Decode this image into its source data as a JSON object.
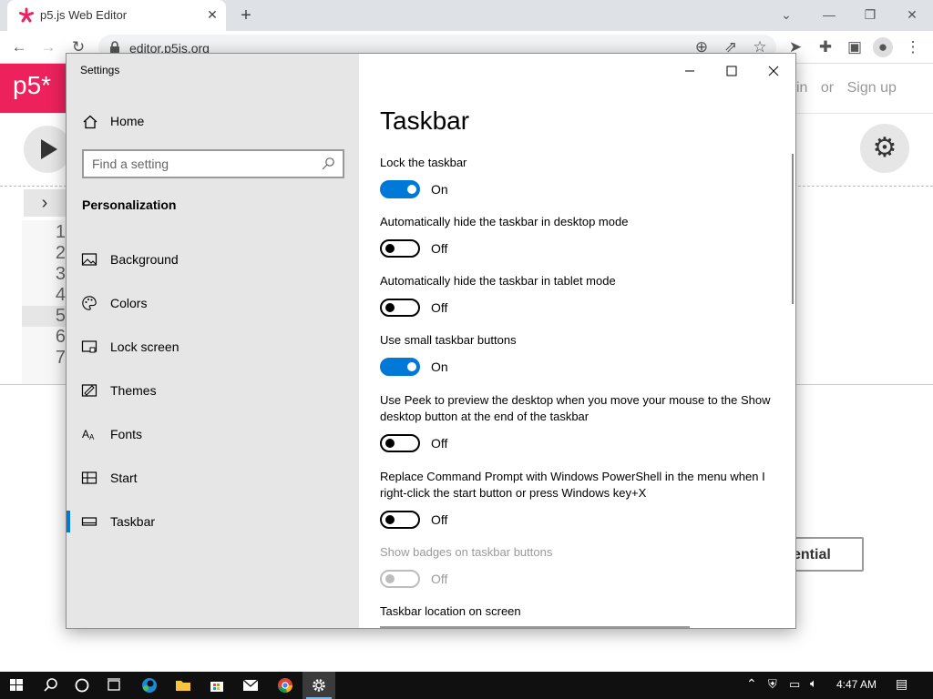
{
  "browser": {
    "tab_title": "p5.js Web Editor",
    "url": "editor.p5js.org"
  },
  "p5": {
    "logo": "p5*",
    "nav_login": "in",
    "nav_or": "or",
    "nav_signup": "Sign up",
    "line_numbers": [
      "1",
      "2",
      "3",
      "4",
      "5",
      "6",
      "7"
    ],
    "credential_button": "ential"
  },
  "settings": {
    "window_title": "Settings",
    "home_label": "Home",
    "search_placeholder": "Find a setting",
    "section": "Personalization",
    "nav_items": [
      {
        "label": "Background",
        "icon": "background-icon"
      },
      {
        "label": "Colors",
        "icon": "palette-icon"
      },
      {
        "label": "Lock screen",
        "icon": "lock-screen-icon"
      },
      {
        "label": "Themes",
        "icon": "themes-icon"
      },
      {
        "label": "Fonts",
        "icon": "fonts-icon"
      },
      {
        "label": "Start",
        "icon": "start-icon"
      },
      {
        "label": "Taskbar",
        "icon": "taskbar-icon",
        "active": true
      }
    ],
    "page_title": "Taskbar",
    "options": [
      {
        "label": "Lock the taskbar",
        "state": "On"
      },
      {
        "label": "Automatically hide the taskbar in desktop mode",
        "state": "Off"
      },
      {
        "label": "Automatically hide the taskbar in tablet mode",
        "state": "Off"
      },
      {
        "label": "Use small taskbar buttons",
        "state": "On"
      },
      {
        "label": "Use Peek to preview the desktop when you move your mouse to the Show desktop button at the end of the taskbar",
        "state": "Off"
      },
      {
        "label": "Replace Command Prompt with Windows PowerShell in the menu when I right-click the start button or press Windows key+X",
        "state": "Off"
      },
      {
        "label": "Show badges on taskbar buttons",
        "state": "Off",
        "disabled": true
      }
    ],
    "location_label": "Taskbar location on screen"
  },
  "taskbar": {
    "time": "4:47 AM"
  },
  "colors": {
    "accent": "#0078d7",
    "p5_brand": "#ed225d"
  }
}
